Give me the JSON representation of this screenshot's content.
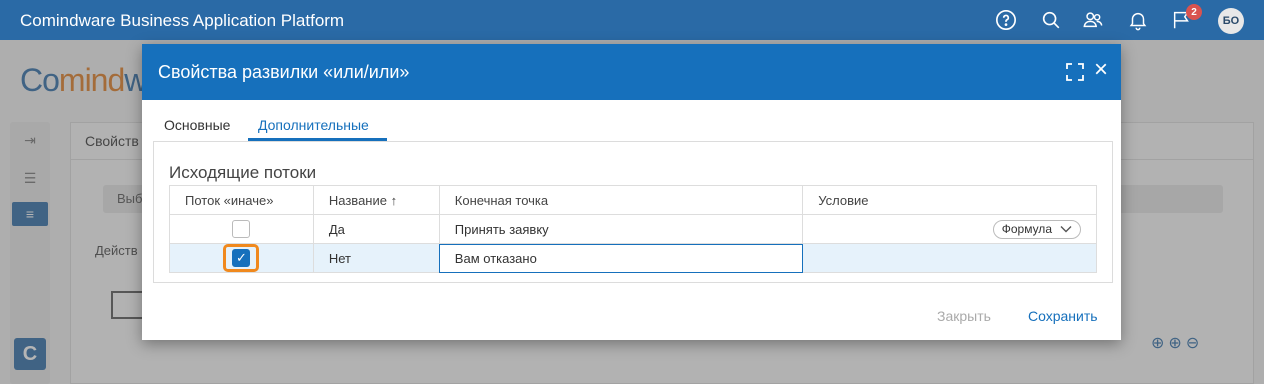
{
  "topbar": {
    "title": "Comindware Business Application Platform",
    "icons": [
      "help-icon",
      "search-icon",
      "users-icon",
      "bell-icon",
      "flag-icon"
    ],
    "flag_badge": "2",
    "avatar": "БО"
  },
  "background": {
    "logo_prefix": "Co",
    "logo_accent": "mind",
    "logo_suffix": "w",
    "panel_header": "Свойств",
    "chip": "Выб",
    "action_label": "Действ"
  },
  "dialog": {
    "title": "Свойства развилки «или/или»",
    "tabs": [
      {
        "label": "Основные",
        "active": false
      },
      {
        "label": "Дополнительные",
        "active": true
      }
    ],
    "section_title": "Исходящие потоки",
    "columns": [
      "Поток «иначе»",
      "Название ↑",
      "Конечная точка",
      "Условие"
    ],
    "rows": [
      {
        "else_checked": false,
        "name": "Да",
        "target": "Принять заявку",
        "condition": "Формула"
      },
      {
        "else_checked": true,
        "name": "Нет",
        "target": "Вам отказано",
        "condition": ""
      }
    ],
    "buttons": {
      "close": "Закрыть",
      "save": "Сохранить"
    }
  },
  "colors": {
    "topbar": "#2a6aa6",
    "dialog_header": "#1670bc",
    "highlight": "#f0891e",
    "selected_row": "#e6f2fb"
  }
}
